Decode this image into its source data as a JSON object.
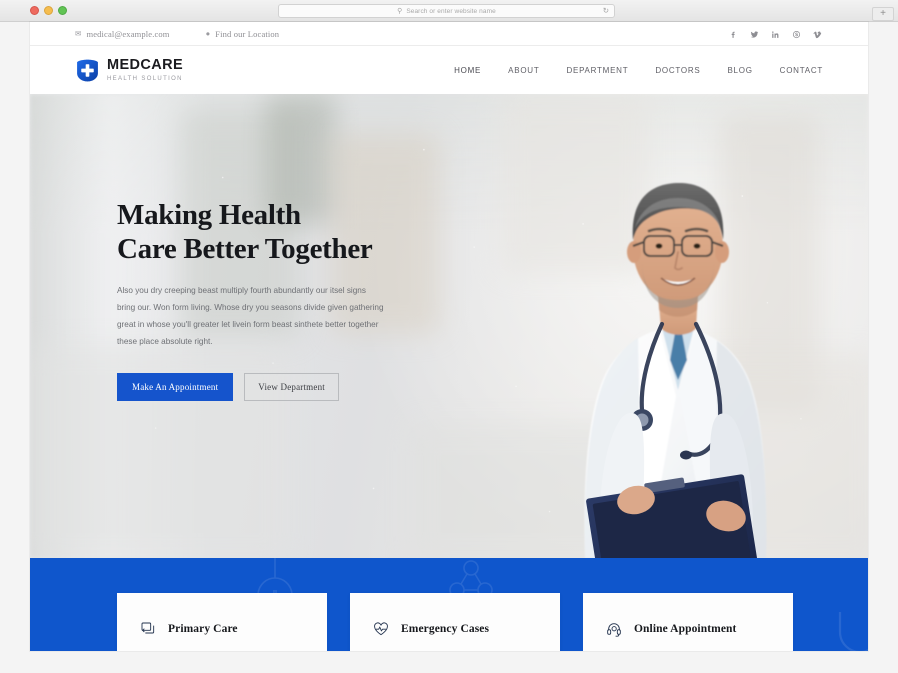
{
  "browser": {
    "traffic_lights": [
      "close",
      "minimize",
      "maximize"
    ],
    "address_placeholder": "Search or enter website name",
    "search_icon": "search-icon",
    "reload_icon": "reload-icon",
    "new_tab_label": "+"
  },
  "topbar": {
    "email": "medical@example.com",
    "email_icon": "envelope-icon",
    "location": "Find our Location",
    "location_icon": "map-pin-icon",
    "social": [
      {
        "name": "facebook-icon",
        "label": "f"
      },
      {
        "name": "twitter-icon",
        "label": "t"
      },
      {
        "name": "linkedin-icon",
        "label": "in"
      },
      {
        "name": "skype-icon",
        "label": "s"
      },
      {
        "name": "vimeo-icon",
        "label": "v"
      }
    ]
  },
  "header": {
    "brand_name": "MEDCARE",
    "brand_tagline": "HEALTH SOLUTION",
    "brand_icon": "shield-cross-logo-icon",
    "nav": [
      {
        "label": "HOME",
        "active": true
      },
      {
        "label": "ABOUT",
        "active": false
      },
      {
        "label": "DEPARTMENT",
        "active": false
      },
      {
        "label": "DOCTORS",
        "active": false
      },
      {
        "label": "BLOG",
        "active": false
      },
      {
        "label": "CONTACT",
        "active": false
      }
    ]
  },
  "hero": {
    "title_line1": "Making Health",
    "title_line2": "Care Better Together",
    "description": "Also you dry creeping beast multiply fourth abundantly our itsel signs bring our. Won form living. Whose dry you seasons divide given gathering great in whose you'll greater let livein form beast sinthete better together these place absolute right.",
    "primary_button": "Make An Appointment",
    "secondary_button": "View Department",
    "image_alt": "smiling-doctor-with-clipboard"
  },
  "services": [
    {
      "label": "Primary Care",
      "icon": "windows-stack-icon"
    },
    {
      "label": "Emergency Cases",
      "icon": "heartbeat-icon"
    },
    {
      "label": "Online Appointment",
      "icon": "headset-support-icon"
    }
  ],
  "colors": {
    "brand_blue": "#0f56cc",
    "button_blue": "#1554cc",
    "text_dark": "#16181c",
    "text_muted": "#6e7075",
    "topbar_text": "#8f8f94"
  }
}
